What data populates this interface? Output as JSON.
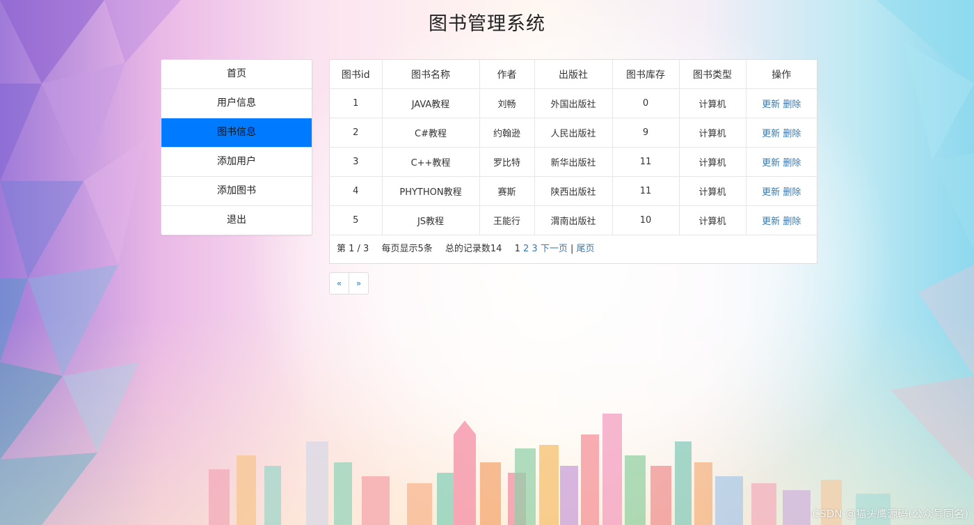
{
  "page": {
    "title": "图书管理系统"
  },
  "sidebar": {
    "items": [
      {
        "label": "首页"
      },
      {
        "label": "用户信息"
      },
      {
        "label": "图书信息"
      },
      {
        "label": "添加用户"
      },
      {
        "label": "添加图书"
      },
      {
        "label": "退出"
      }
    ],
    "active_index": 2
  },
  "table": {
    "headers": [
      "图书id",
      "图书名称",
      "作者",
      "出版社",
      "图书库存",
      "图书类型",
      "操作"
    ],
    "rows": [
      {
        "id": "1",
        "name": "JAVA教程",
        "author": "刘畅",
        "publisher": "外国出版社",
        "stock": "0",
        "type": "计算机",
        "update": "更新",
        "delete": "删除"
      },
      {
        "id": "2",
        "name": "C#教程",
        "author": "约翰逊",
        "publisher": "人民出版社",
        "stock": "9",
        "type": "计算机",
        "update": "更新",
        "delete": "删除"
      },
      {
        "id": "3",
        "name": "C++教程",
        "author": "罗比特",
        "publisher": "新华出版社",
        "stock": "11",
        "type": "计算机",
        "update": "更新",
        "delete": "删除"
      },
      {
        "id": "4",
        "name": "PHYTHON教程",
        "author": "赛斯",
        "publisher": "陕西出版社",
        "stock": "11",
        "type": "计算机",
        "update": "更新",
        "delete": "删除"
      },
      {
        "id": "5",
        "name": "JS教程",
        "author": "王能行",
        "publisher": "渭南出版社",
        "stock": "10",
        "type": "计算机",
        "update": "更新",
        "delete": "删除"
      }
    ]
  },
  "pagination": {
    "page_info": "第 1 / 3",
    "per_page": "每页显示5条",
    "total": "总的记录数14",
    "current": "1",
    "page2": "2",
    "page3": "3",
    "next": "下一页",
    "separator": "|",
    "last": "尾页",
    "prev_arrow": "«",
    "next_arrow": "»"
  },
  "watermark": "CSDN @猫头鹰源码(公众号同名)",
  "colors": {
    "active_menu": "#007bff",
    "link": "#337ab7"
  }
}
